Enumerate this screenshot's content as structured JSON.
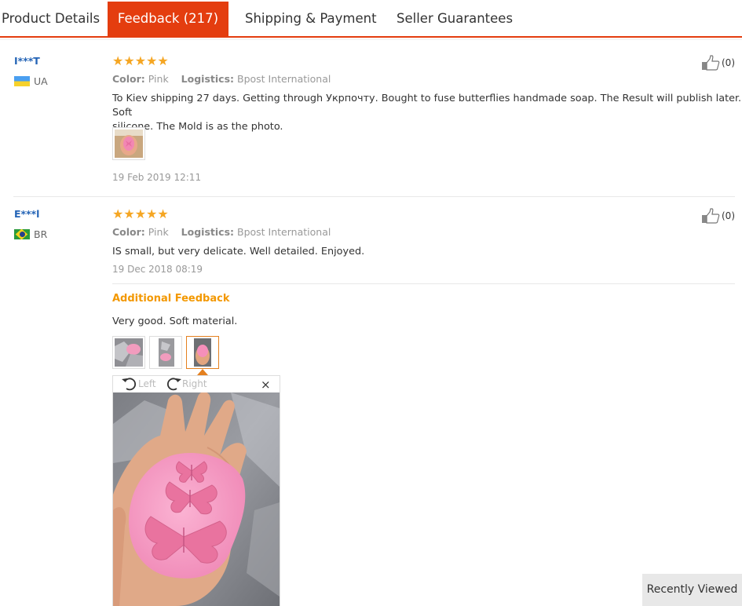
{
  "tabs": [
    {
      "label": "Product Details",
      "active": false
    },
    {
      "label": "Feedback (217)",
      "active": true
    },
    {
      "label": "Shipping & Payment",
      "active": false
    },
    {
      "label": "Seller Guarantees",
      "active": false
    }
  ],
  "reviews": [
    {
      "user": "I***T",
      "country": "UA",
      "stars": "★★★★★",
      "rating": 5,
      "color_label": "Color:",
      "color_value": "Pink",
      "logistics_label": "Logistics:",
      "logistics_value": "Bpost International",
      "text_line1": "To Kiev shipping 27 days. Getting through Укрпочту. Bought to fuse butterflies handmade soap. The Result will publish later. Soft",
      "text_line2": "silicone. The Mold is as the photo.",
      "date": "19 Feb 2019 12:11",
      "likes": "(0)"
    },
    {
      "user": "E***l",
      "country": "BR",
      "stars": "★★★★★",
      "rating": 5,
      "color_label": "Color:",
      "color_value": "Pink",
      "logistics_label": "Logistics:",
      "logistics_value": "Bpost International",
      "text": "IS small, but very delicate. Well detailed. Enjoyed.",
      "date": "19 Dec 2018 08:19",
      "likes": "(0)",
      "additional_title": "Additional Feedback",
      "additional_text": "Very good. Soft material."
    }
  ],
  "viewer": {
    "rotate_left": "Left",
    "rotate_right": "Right",
    "close": "×"
  },
  "recently_viewed": "Recently Viewed",
  "colors": {
    "accent": "#e43d0f",
    "star": "#f5a623",
    "link": "#2464b6",
    "additional": "#f39800",
    "product_pink": "#f49ac1"
  }
}
